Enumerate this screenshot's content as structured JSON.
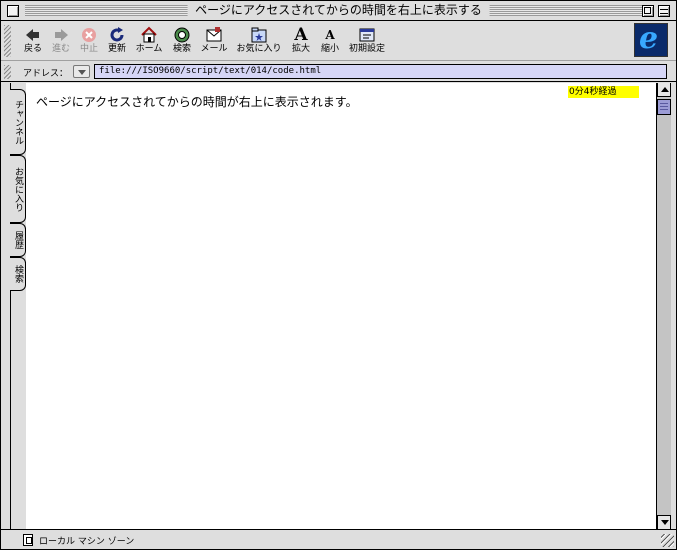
{
  "window": {
    "title": "ページにアクセスされてからの時間を右上に表示する"
  },
  "toolbar": {
    "buttons": [
      {
        "label": "戻る",
        "icon": "back-arrow-icon",
        "enabled": true
      },
      {
        "label": "進む",
        "icon": "forward-arrow-icon",
        "enabled": false
      },
      {
        "label": "中止",
        "icon": "stop-icon",
        "enabled": false
      },
      {
        "label": "更新",
        "icon": "refresh-icon",
        "enabled": true
      },
      {
        "label": "ホーム",
        "icon": "home-icon",
        "enabled": true
      },
      {
        "label": "検索",
        "icon": "search-icon",
        "enabled": true
      },
      {
        "label": "メール",
        "icon": "mail-icon",
        "enabled": true
      },
      {
        "label": "お気に入り",
        "icon": "favorites-icon",
        "enabled": true
      },
      {
        "label": "拡大",
        "icon": "text-larger-icon",
        "enabled": true
      },
      {
        "label": "縮小",
        "icon": "text-smaller-icon",
        "enabled": true
      },
      {
        "label": "初期設定",
        "icon": "preferences-icon",
        "enabled": true
      }
    ]
  },
  "address": {
    "label": "アドレス：",
    "url": "file:///ISO9660/script/text/014/code.html"
  },
  "sidetabs": [
    "チャンネル",
    "お気に入り",
    "履歴",
    "検索"
  ],
  "content": {
    "text": "ページにアクセスされてからの時間が右上に表示されます。",
    "elapsed": "0分4秒経過"
  },
  "status": {
    "zone": "ローカル マシン ゾーン"
  },
  "colors": {
    "chrome": "#dedede",
    "address_field": "#d6d6f6",
    "elapsed_highlight": "#ffff00",
    "scroll_thumb": "#9c9cd6"
  }
}
